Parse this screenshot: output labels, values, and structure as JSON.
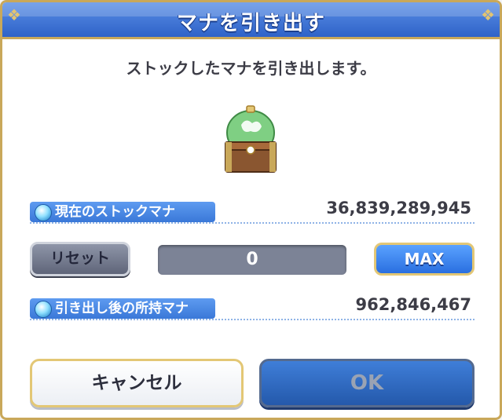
{
  "dialog": {
    "title": "マナを引き出す",
    "message": "ストックしたマナを引き出します。"
  },
  "icons": {
    "chest": "mana-chest-icon",
    "gem": "mana-gem-icon"
  },
  "rows": {
    "current_stock": {
      "label": "現在のストックマナ",
      "value": "36,839,289,945"
    },
    "after_withdraw": {
      "label": "引き出し後の所持マナ",
      "value": "962,846,467"
    }
  },
  "controls": {
    "reset_label": "リセット",
    "amount_value": "0",
    "max_label": "MAX"
  },
  "footer": {
    "cancel_label": "キャンセル",
    "ok_label": "OK"
  },
  "colors": {
    "title_bar": "#2f63c8",
    "accent_gold": "#c9a85a",
    "label_blue": "#3a78d8",
    "ok_button": "#2459ab",
    "reset_button": "#5f6579"
  }
}
